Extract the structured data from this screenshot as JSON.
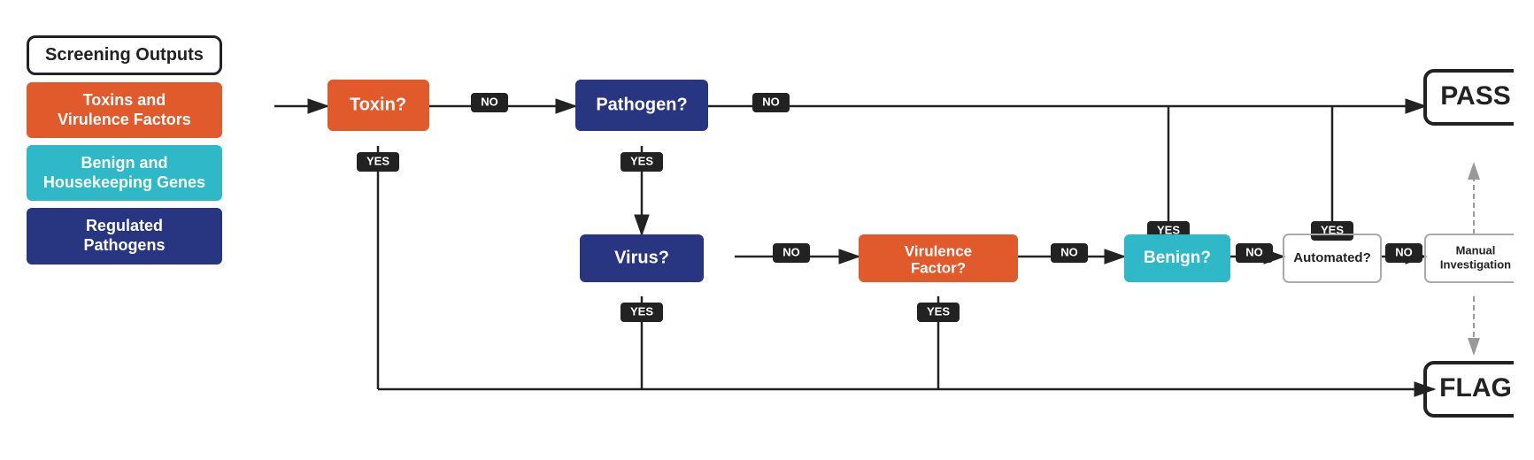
{
  "legend": {
    "screening_outputs": "Screening Outputs",
    "toxins_label": "Toxins and\nVirulence Factors",
    "benign_label": "Benign and\nHousekeeping Genes",
    "regulated_label": "Regulated\nPathogens"
  },
  "nodes": {
    "toxin": "Toxin?",
    "pathogen": "Pathogen?",
    "virus": "Virus?",
    "virulence": "Virulence\nFactor?",
    "benign": "Benign?",
    "automated": "Automated?",
    "manual": "Manual\nInvestigation",
    "pass": "PASS",
    "flag": "FLAG"
  },
  "badges": {
    "no": "NO",
    "yes": "YES"
  },
  "colors": {
    "orange": "#e05a2b",
    "dark_blue": "#283580",
    "teal": "#2eb8c8",
    "light_gray": "#ccc",
    "dark": "#222",
    "white": "#fff"
  }
}
